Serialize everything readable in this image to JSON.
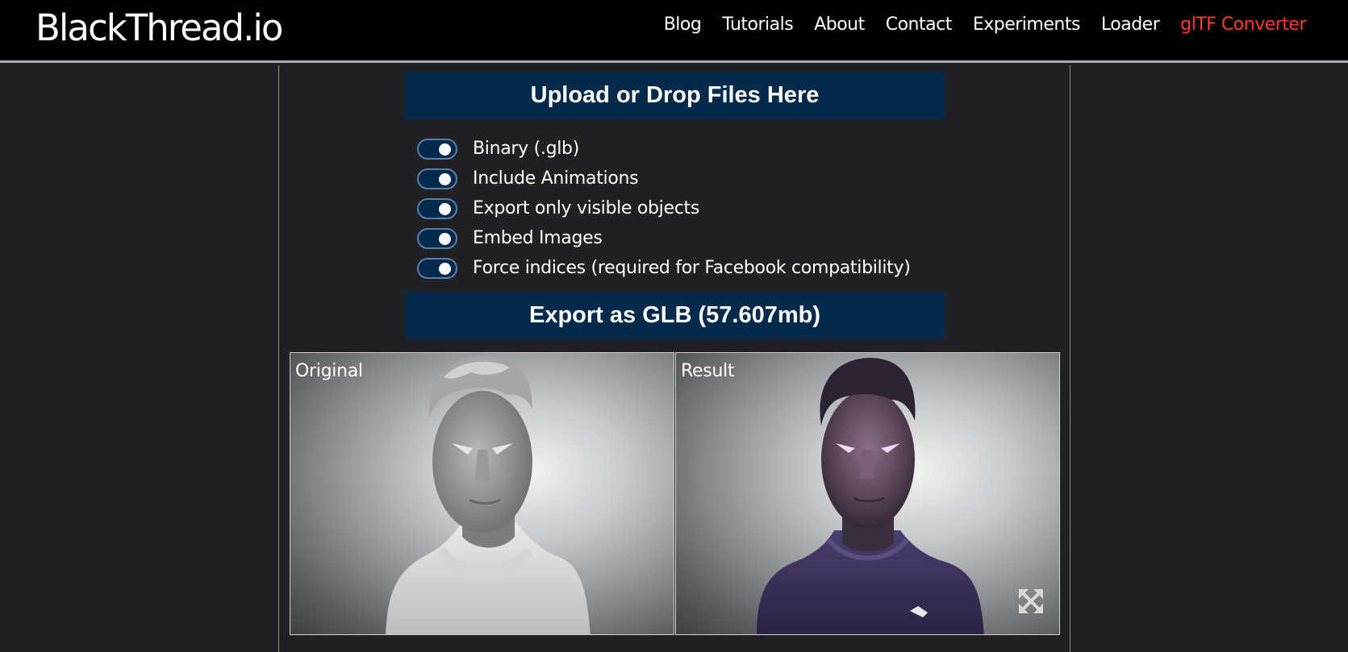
{
  "header": {
    "logo": "BlackThread.io",
    "nav": [
      {
        "label": "Blog"
      },
      {
        "label": "Tutorials"
      },
      {
        "label": "About"
      },
      {
        "label": "Contact"
      },
      {
        "label": "Experiments"
      },
      {
        "label": "Loader"
      },
      {
        "label": "glTF Converter",
        "active": true
      }
    ]
  },
  "upload": {
    "label": "Upload or Drop Files Here"
  },
  "options": [
    {
      "label": "Binary (.glb)",
      "enabled": true
    },
    {
      "label": "Include Animations",
      "enabled": true
    },
    {
      "label": "Export only visible objects",
      "enabled": true
    },
    {
      "label": "Embed Images",
      "enabled": true
    },
    {
      "label": "Force indices (required for Facebook compatibility)",
      "enabled": true
    }
  ],
  "export": {
    "label": "Export as GLB (57.607mb)"
  },
  "viewers": {
    "original": {
      "label": "Original"
    },
    "result": {
      "label": "Result"
    }
  },
  "icons": {
    "expand": "expand-arrows-icon",
    "toggle": "toggle-switch-icon"
  },
  "colors": {
    "background": "#212123",
    "navbar": "#000000",
    "button": "#062a4c",
    "active_link": "#ff3b2a"
  }
}
